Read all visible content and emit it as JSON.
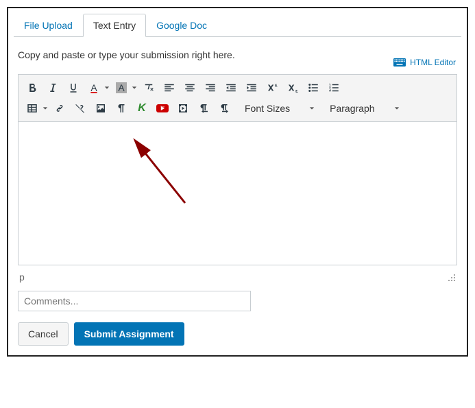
{
  "tabs": {
    "file_upload": "File Upload",
    "text_entry": "Text Entry",
    "google_doc": "Google Doc"
  },
  "instruction": "Copy and paste or type your submission right here.",
  "html_editor_label": "HTML Editor",
  "toolbar": {
    "font_sizes_label": "Font Sizes",
    "paragraph_label": "Paragraph"
  },
  "path_display": "p",
  "comments_placeholder": "Comments...",
  "buttons": {
    "cancel": "Cancel",
    "submit": "Submit Assignment"
  }
}
